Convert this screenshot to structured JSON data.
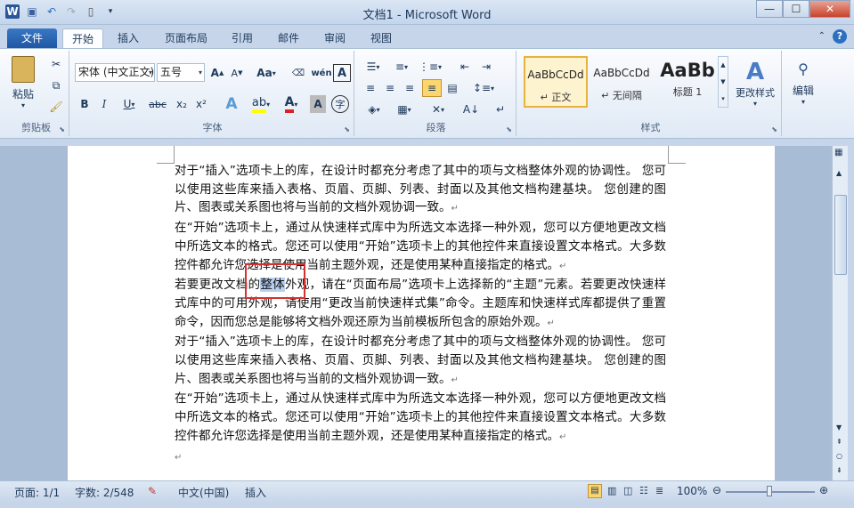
{
  "window": {
    "title": "文档1 - Microsoft Word"
  },
  "tabs": [
    "文件",
    "开始",
    "插入",
    "页面布局",
    "引用",
    "邮件",
    "审阅",
    "视图"
  ],
  "clipboard": {
    "paste_label": "粘贴",
    "group_label": "剪贴板"
  },
  "font": {
    "name": "宋体 (中文正文)",
    "size": "五号",
    "group_label": "字体",
    "aa_label": "Aa",
    "a_label": "A",
    "b": "B",
    "i": "I",
    "u": "U",
    "abc": "abc",
    "x2": "x₂",
    "x2sup": "x²"
  },
  "paragraph": {
    "group_label": "段落"
  },
  "styles": {
    "items": [
      {
        "sample": "AaBbCcDd",
        "name": "↵ 正文"
      },
      {
        "sample": "AaBbCcDd",
        "name": "↵ 无间隔"
      },
      {
        "sample": "AaBb",
        "name": "标题 1"
      }
    ],
    "change_label": "更改样式",
    "group_label": "样式"
  },
  "editing": {
    "label": "编辑"
  },
  "document": {
    "paragraphs": [
      "对于“插入”选项卡上的库，在设计时都充分考虑了其中的项与文档整体外观的协调性。 您可以使用这些库来插入表格、页眉、页脚、列表、封面以及其他文档构建基块。 您创建的图片、图表或关系图也将与当前的文档外观协调一致。",
      "在“开始”选项卡上，通过从快速样式库中为所选文本选择一种外观，您可以方便地更改文档中所选文本的格式。您还可以使用“开始”选项卡上的其他控件来直接设置文本格式。大多数控件都允许您选择是使用当前主题外观，还是使用某种直接指定的格式。",
      "若要更改文档的",
      "整体",
      "外观，请在“页面布局”选项卡上选择新的“主题”元素。若要更改快速样式库中的可用外观，请使用“更改当前快速样式集”命令。主题库和快速样式库都提供了重置命令，因而您总是能够将文档外观还原为当前模板所包含的原始外观。",
      "对于“插入”选项卡上的库，在设计时都充分考虑了其中的项与文档整体外观的协调性。 您可以使用这些库来插入表格、页眉、页脚、列表、封面以及其他文档构建基块。 您创建的图片、图表或关系图也将与当前的文档外观协调一致。",
      "在“开始”选项卡上，通过从快速样式库中为所选文本选择一种外观，您可以方便地更改文档中所选文本的格式。您还可以使用“开始”选项卡上的其他控件来直接设置文本格式。大多数控件都允许您选择是使用当前主题外观，还是使用某种直接指定的格式。"
    ],
    "pilcrow": "↵"
  },
  "status": {
    "page": "页面: 1/1",
    "words": "字数: 2/548",
    "language": "中文(中国)",
    "mode": "插入",
    "zoom": "100%"
  }
}
